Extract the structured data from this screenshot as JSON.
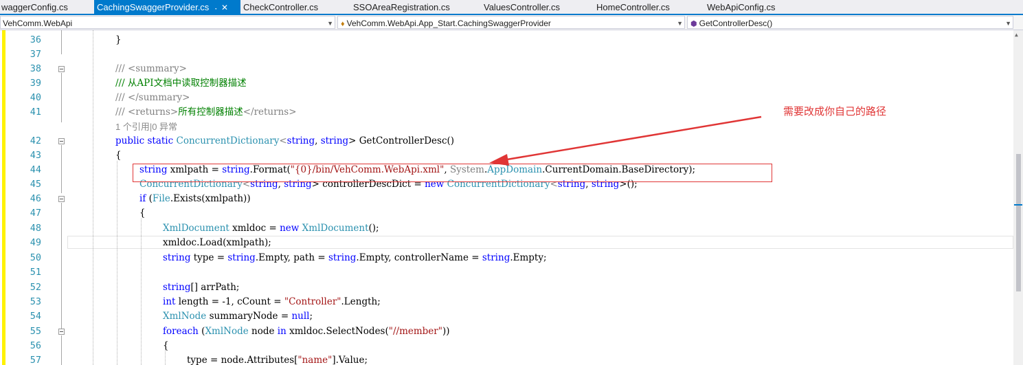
{
  "tabs": [
    {
      "label": "waggerConfig.cs",
      "active": false
    },
    {
      "label": "CachingSwaggerProvider.cs",
      "active": true
    },
    {
      "label": "CheckController.cs",
      "active": false
    },
    {
      "label": "SSOAreaRegistration.cs",
      "active": false
    },
    {
      "label": "ValuesController.cs",
      "active": false
    },
    {
      "label": "HomeController.cs",
      "active": false
    },
    {
      "label": "WebApiConfig.cs",
      "active": false
    }
  ],
  "tab_icons": {
    "pin": "pin-icon",
    "close": "close-icon"
  },
  "nav": {
    "project": "VehComm.WebApi",
    "class": "VehComm.WebApi.App_Start.CachingSwaggerProvider",
    "member": "GetControllerDesc()"
  },
  "line_numbers": [
    "36",
    "37",
    "38",
    "39",
    "40",
    "41",
    "42",
    "43",
    "44",
    "45",
    "46",
    "47",
    "48",
    "49",
    "50",
    "51",
    "52",
    "53",
    "54",
    "55",
    "56",
    "57"
  ],
  "codelens": "1 个引用|0 异常",
  "annotation": "需要改成你自己的路径",
  "colors": {
    "keyword": "#0000ff",
    "type": "#2b91af",
    "string": "#a31515",
    "comment": "#008000",
    "annotation": "#e03535",
    "accent": "#007acc"
  },
  "code": {
    "l36": "}",
    "l38a": "/// ",
    "l38b": "<summary>",
    "l39": "/// 从API文档中读取控制器描述",
    "l40a": "/// ",
    "l40b": "</summary>",
    "l41a": "/// ",
    "l41b": "<returns>",
    "l41c": "所有控制器描述",
    "l41d": "</returns>",
    "l42a": "public",
    "l42b": " ",
    "l42c": "static",
    "l42d": " ",
    "l42e": "ConcurrentDictionary",
    "l42f": "<",
    "l42g": "string",
    "l42h": ", ",
    "l42i": "string",
    "l42j": "> GetControllerDesc()",
    "l43": "{",
    "l44a": "string",
    "l44b": " xmlpath = ",
    "l44c": "string",
    "l44d": ".Format(",
    "l44e": "\"{0}/bin/VehComm.WebApi.xml\"",
    "l44f": ", ",
    "l44g": "System",
    "l44h": ".",
    "l44i": "AppDomain",
    "l44j": ".CurrentDomain.BaseDirectory);",
    "l45a": "ConcurrentDictionary",
    "l45b": "<",
    "l45c": "string",
    "l45d": ", ",
    "l45e": "string",
    "l45f": "> controllerDescDict = ",
    "l45g": "new",
    "l45h": " ",
    "l45i": "ConcurrentDictionary",
    "l45j": "<",
    "l45k": "string",
    "l45l": ", ",
    "l45m": "string",
    "l45n": ">();",
    "l46a": "if",
    "l46b": " (",
    "l46c": "File",
    "l46d": ".Exists(xmlpath))",
    "l47": "{",
    "l48a": "XmlDocument",
    "l48b": " xmldoc = ",
    "l48c": "new",
    "l48d": " ",
    "l48e": "XmlDocument",
    "l48f": "();",
    "l49": "xmldoc.Load(xmlpath);",
    "l50a": "string",
    "l50b": " type = ",
    "l50c": "string",
    "l50d": ".Empty, path = ",
    "l50e": "string",
    "l50f": ".Empty, controllerName = ",
    "l50g": "string",
    "l50h": ".Empty;",
    "l52a": "string",
    "l52b": "[] arrPath;",
    "l53a": "int",
    "l53b": " length = -1, cCount = ",
    "l53c": "\"Controller\"",
    "l53d": ".Length;",
    "l54a": "XmlNode",
    "l54b": " summaryNode = ",
    "l54c": "null",
    "l54d": ";",
    "l55a": "foreach",
    "l55b": " (",
    "l55c": "XmlNode",
    "l55d": " node ",
    "l55e": "in",
    "l55f": " xmldoc.SelectNodes(",
    "l55g": "\"//member\"",
    "l55h": "))",
    "l56": "{",
    "l57a": "type = node.Attributes[",
    "l57b": "\"name\"",
    "l57c": "].Value;"
  }
}
